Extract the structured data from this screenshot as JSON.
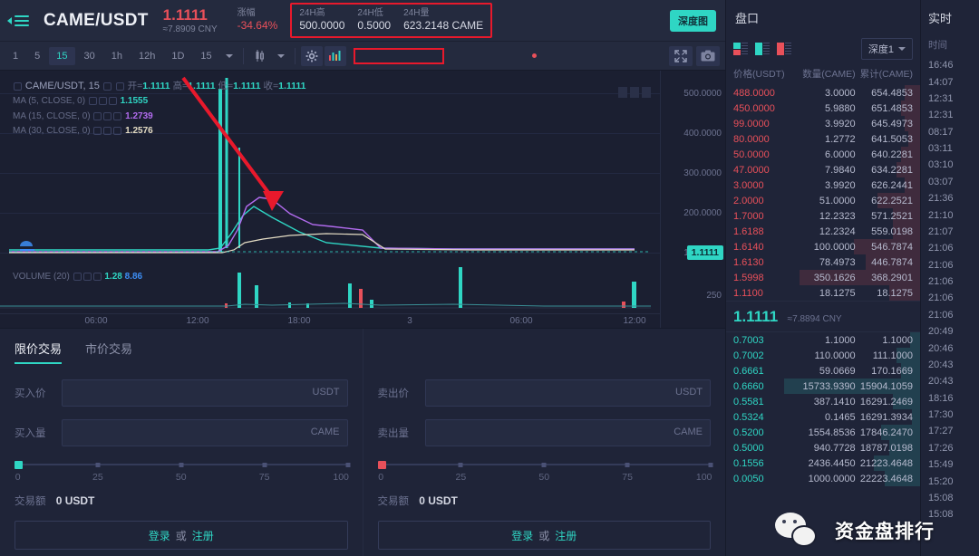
{
  "header": {
    "pair": "CAME/USDT",
    "last_price": "1.1111",
    "last_price_cny": "≈7.8909 CNY",
    "change_label": "涨幅",
    "change_value": "-34.64%",
    "stats": [
      {
        "label": "24H高",
        "value": "500.0000"
      },
      {
        "label": "24H低",
        "value": "0.5000"
      },
      {
        "label": "24H量",
        "value": "623.2148 CAME"
      }
    ],
    "depth_button": "深度图"
  },
  "toolbar": {
    "timeframes": [
      "1",
      "5",
      "15",
      "30",
      "1h",
      "12h",
      "1D",
      "15"
    ],
    "active_timeframe": "15"
  },
  "chart": {
    "legend_title": "CAME/USDT, 15",
    "ohlc": [
      {
        "key": "开=",
        "value": "1.1111"
      },
      {
        "key": "高=",
        "value": "1.1111"
      },
      {
        "key": "低=",
        "value": "1.1111"
      },
      {
        "key": "收=",
        "value": "1.1111"
      }
    ],
    "ma": [
      {
        "label": "MA (5, CLOSE, 0)",
        "value": "1.1555",
        "color": "teal"
      },
      {
        "label": "MA (15, CLOSE, 0)",
        "value": "1.2739",
        "color": "purple"
      },
      {
        "label": "MA (30, CLOSE, 0)",
        "value": "1.2576",
        "color": "cream"
      }
    ],
    "price_ticks": [
      "500.0000",
      "400.0000",
      "300.0000",
      "200.0000",
      "100.0000"
    ],
    "current_price_tag": "1.1111",
    "volume_label": "VOLUME (20)",
    "volume_values": [
      {
        "value": "1.28",
        "color": "teal"
      },
      {
        "value": "8.86",
        "color": "blue"
      }
    ],
    "volume_tick": "250",
    "time_ticks": [
      "06:00",
      "12:00",
      "18:00",
      "3",
      "06:00",
      "12:00"
    ]
  },
  "trade": {
    "tabs": [
      "限价交易",
      "市价交易"
    ],
    "active_tab": "限价交易",
    "buy": {
      "price_label": "买入价",
      "price_unit": "USDT",
      "price_value": "",
      "amount_label": "买入量",
      "amount_unit": "CAME",
      "amount_value": "",
      "total_label": "交易额",
      "total_value": "0 USDT"
    },
    "sell": {
      "price_label": "卖出价",
      "price_unit": "USDT",
      "price_value": "",
      "amount_label": "卖出量",
      "amount_unit": "CAME",
      "amount_value": "",
      "total_label": "交易额",
      "total_value": "0 USDT"
    },
    "slider_scale": [
      "0",
      "25",
      "50",
      "75",
      "100"
    ],
    "login_text": "登录",
    "or_text": "或",
    "register_text": "注册"
  },
  "orderbook": {
    "title": "盘口",
    "depth_select": "深度1",
    "columns": [
      "价格(USDT)",
      "数量(CAME)",
      "累计(CAME)"
    ],
    "asks": [
      {
        "price": "488.0000",
        "amount": "3.0000",
        "total": "654.4853",
        "fill": 8
      },
      {
        "price": "450.0000",
        "amount": "5.9880",
        "total": "651.4853",
        "fill": 10
      },
      {
        "price": "99.0000",
        "amount": "3.9920",
        "total": "645.4973",
        "fill": 8
      },
      {
        "price": "80.0000",
        "amount": "1.2772",
        "total": "641.5053",
        "fill": 6
      },
      {
        "price": "50.0000",
        "amount": "6.0000",
        "total": "640.2281",
        "fill": 10
      },
      {
        "price": "47.0000",
        "amount": "7.9840",
        "total": "634.2281",
        "fill": 12
      },
      {
        "price": "3.0000",
        "amount": "3.9920",
        "total": "626.2441",
        "fill": 8
      },
      {
        "price": "2.0000",
        "amount": "51.0000",
        "total": "622.2521",
        "fill": 22
      },
      {
        "price": "1.7000",
        "amount": "12.2323",
        "total": "571.2521",
        "fill": 14
      },
      {
        "price": "1.6188",
        "amount": "12.2324",
        "total": "559.0198",
        "fill": 14
      },
      {
        "price": "1.6140",
        "amount": "100.0000",
        "total": "546.7874",
        "fill": 34
      },
      {
        "price": "1.6130",
        "amount": "78.4973",
        "total": "446.7874",
        "fill": 28
      },
      {
        "price": "1.5998",
        "amount": "350.1626",
        "total": "368.2901",
        "fill": 62
      },
      {
        "price": "1.1100",
        "amount": "18.1275",
        "total": "18.1275",
        "fill": 16
      }
    ],
    "mid_price": "1.1111",
    "mid_price_cny": "≈7.8894 CNY",
    "bids": [
      {
        "price": "0.7003",
        "amount": "1.1000",
        "total": "1.1000",
        "fill": 5
      },
      {
        "price": "0.7002",
        "amount": "110.0000",
        "total": "111.1000",
        "fill": 12
      },
      {
        "price": "0.6661",
        "amount": "59.0669",
        "total": "170.1669",
        "fill": 10
      },
      {
        "price": "0.6660",
        "amount": "15733.9390",
        "total": "15904.1059",
        "fill": 70
      },
      {
        "price": "0.5581",
        "amount": "387.1410",
        "total": "16291.2469",
        "fill": 14
      },
      {
        "price": "0.5324",
        "amount": "0.1465",
        "total": "16291.3934",
        "fill": 4
      },
      {
        "price": "0.5200",
        "amount": "1554.8536",
        "total": "17846.2470",
        "fill": 20
      },
      {
        "price": "0.5000",
        "amount": "940.7728",
        "total": "18787.0198",
        "fill": 16
      },
      {
        "price": "0.1556",
        "amount": "2436.4450",
        "total": "21223.4648",
        "fill": 24
      },
      {
        "price": "0.0050",
        "amount": "1000.0000",
        "total": "22223.4648",
        "fill": 18
      }
    ]
  },
  "trades_panel": {
    "title": "实时",
    "column": "时间",
    "times": [
      "16:46",
      "14:07",
      "12:31",
      "12:31",
      "08:17",
      "03:11",
      "03:10",
      "03:07",
      "21:36",
      "21:10",
      "21:07",
      "21:06",
      "21:06",
      "21:06",
      "21:06",
      "21:06",
      "20:49",
      "20:46",
      "20:43",
      "20:43",
      "18:16",
      "17:30",
      "17:27",
      "17:26",
      "15:49",
      "15:20",
      "15:08",
      "15:08"
    ]
  },
  "watermark": {
    "text": "资金盘排行"
  }
}
